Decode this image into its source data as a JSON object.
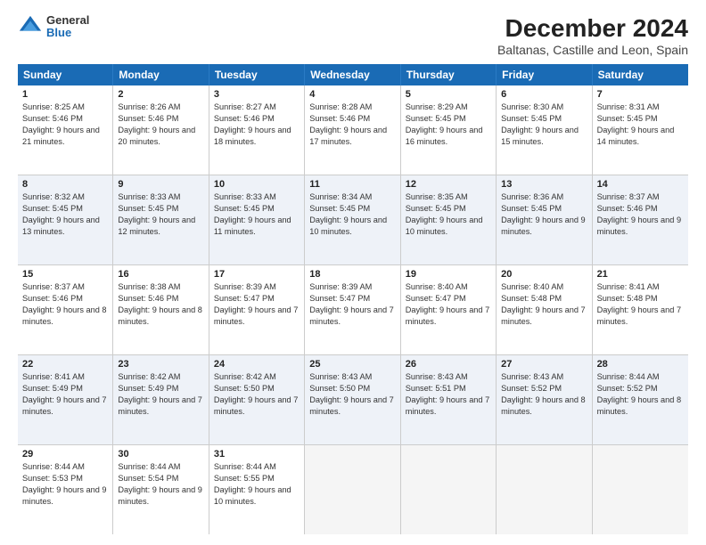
{
  "header": {
    "logo": {
      "line1": "General",
      "line2": "Blue"
    },
    "title": "December 2024",
    "subtitle": "Baltanas, Castille and Leon, Spain"
  },
  "calendar": {
    "headers": [
      "Sunday",
      "Monday",
      "Tuesday",
      "Wednesday",
      "Thursday",
      "Friday",
      "Saturday"
    ],
    "rows": [
      [
        {
          "day": "1",
          "sunrise": "8:25 AM",
          "sunset": "5:46 PM",
          "daylight": "9 hours and 21 minutes."
        },
        {
          "day": "2",
          "sunrise": "8:26 AM",
          "sunset": "5:46 PM",
          "daylight": "9 hours and 20 minutes."
        },
        {
          "day": "3",
          "sunrise": "8:27 AM",
          "sunset": "5:46 PM",
          "daylight": "9 hours and 18 minutes."
        },
        {
          "day": "4",
          "sunrise": "8:28 AM",
          "sunset": "5:46 PM",
          "daylight": "9 hours and 17 minutes."
        },
        {
          "day": "5",
          "sunrise": "8:29 AM",
          "sunset": "5:45 PM",
          "daylight": "9 hours and 16 minutes."
        },
        {
          "day": "6",
          "sunrise": "8:30 AM",
          "sunset": "5:45 PM",
          "daylight": "9 hours and 15 minutes."
        },
        {
          "day": "7",
          "sunrise": "8:31 AM",
          "sunset": "5:45 PM",
          "daylight": "9 hours and 14 minutes."
        }
      ],
      [
        {
          "day": "8",
          "sunrise": "8:32 AM",
          "sunset": "5:45 PM",
          "daylight": "9 hours and 13 minutes."
        },
        {
          "day": "9",
          "sunrise": "8:33 AM",
          "sunset": "5:45 PM",
          "daylight": "9 hours and 12 minutes."
        },
        {
          "day": "10",
          "sunrise": "8:33 AM",
          "sunset": "5:45 PM",
          "daylight": "9 hours and 11 minutes."
        },
        {
          "day": "11",
          "sunrise": "8:34 AM",
          "sunset": "5:45 PM",
          "daylight": "9 hours and 10 minutes."
        },
        {
          "day": "12",
          "sunrise": "8:35 AM",
          "sunset": "5:45 PM",
          "daylight": "9 hours and 10 minutes."
        },
        {
          "day": "13",
          "sunrise": "8:36 AM",
          "sunset": "5:45 PM",
          "daylight": "9 hours and 9 minutes."
        },
        {
          "day": "14",
          "sunrise": "8:37 AM",
          "sunset": "5:46 PM",
          "daylight": "9 hours and 9 minutes."
        }
      ],
      [
        {
          "day": "15",
          "sunrise": "8:37 AM",
          "sunset": "5:46 PM",
          "daylight": "9 hours and 8 minutes."
        },
        {
          "day": "16",
          "sunrise": "8:38 AM",
          "sunset": "5:46 PM",
          "daylight": "9 hours and 8 minutes."
        },
        {
          "day": "17",
          "sunrise": "8:39 AM",
          "sunset": "5:47 PM",
          "daylight": "9 hours and 7 minutes."
        },
        {
          "day": "18",
          "sunrise": "8:39 AM",
          "sunset": "5:47 PM",
          "daylight": "9 hours and 7 minutes."
        },
        {
          "day": "19",
          "sunrise": "8:40 AM",
          "sunset": "5:47 PM",
          "daylight": "9 hours and 7 minutes."
        },
        {
          "day": "20",
          "sunrise": "8:40 AM",
          "sunset": "5:48 PM",
          "daylight": "9 hours and 7 minutes."
        },
        {
          "day": "21",
          "sunrise": "8:41 AM",
          "sunset": "5:48 PM",
          "daylight": "9 hours and 7 minutes."
        }
      ],
      [
        {
          "day": "22",
          "sunrise": "8:41 AM",
          "sunset": "5:49 PM",
          "daylight": "9 hours and 7 minutes."
        },
        {
          "day": "23",
          "sunrise": "8:42 AM",
          "sunset": "5:49 PM",
          "daylight": "9 hours and 7 minutes."
        },
        {
          "day": "24",
          "sunrise": "8:42 AM",
          "sunset": "5:50 PM",
          "daylight": "9 hours and 7 minutes."
        },
        {
          "day": "25",
          "sunrise": "8:43 AM",
          "sunset": "5:50 PM",
          "daylight": "9 hours and 7 minutes."
        },
        {
          "day": "26",
          "sunrise": "8:43 AM",
          "sunset": "5:51 PM",
          "daylight": "9 hours and 7 minutes."
        },
        {
          "day": "27",
          "sunrise": "8:43 AM",
          "sunset": "5:52 PM",
          "daylight": "9 hours and 8 minutes."
        },
        {
          "day": "28",
          "sunrise": "8:44 AM",
          "sunset": "5:52 PM",
          "daylight": "9 hours and 8 minutes."
        }
      ],
      [
        {
          "day": "29",
          "sunrise": "8:44 AM",
          "sunset": "5:53 PM",
          "daylight": "9 hours and 9 minutes."
        },
        {
          "day": "30",
          "sunrise": "8:44 AM",
          "sunset": "5:54 PM",
          "daylight": "9 hours and 9 minutes."
        },
        {
          "day": "31",
          "sunrise": "8:44 AM",
          "sunset": "5:55 PM",
          "daylight": "9 hours and 10 minutes."
        },
        null,
        null,
        null,
        null
      ]
    ]
  }
}
